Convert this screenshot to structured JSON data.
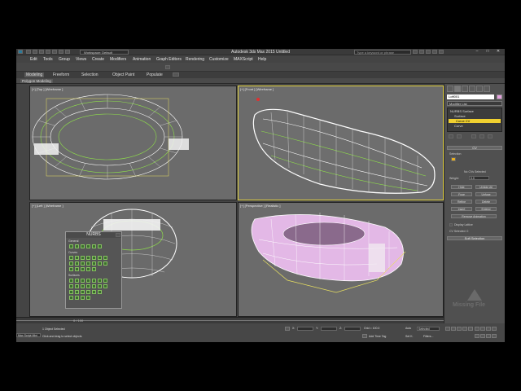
{
  "window": {
    "title": "Autodesk 3ds Max  2015    Untitled",
    "workspace": "Workspace: Default",
    "search_placeholder": "Type a keyword or phrase",
    "controls": [
      "–",
      "□",
      "✕"
    ]
  },
  "menu": [
    "Edit",
    "Tools",
    "Group",
    "Views",
    "Create",
    "Modifiers",
    "Animation",
    "Graph Editors",
    "Rendering",
    "Customize",
    "MAXScript",
    "Help"
  ],
  "ribbon": {
    "tabs": [
      "Modeling",
      "Freeform",
      "Selection",
      "Object Paint",
      "Populate"
    ],
    "active_tab": "Modeling",
    "panel_label": "Polygon Modeling"
  },
  "viewports": [
    {
      "label": "[+] [Top ] [Wireframe ]"
    },
    {
      "label": "[+] [Front ] [Wireframe ]"
    },
    {
      "label": "[+] [Left ] [Wireframe ]"
    },
    {
      "label": "[+] [Perspective ] [Realistic ]"
    }
  ],
  "command_panel": {
    "object_name": "Loft001",
    "object_color": "#e7a0e0",
    "modifier_list": "Modifier List",
    "stack": [
      "NURBS Surface",
      "Surface",
      "Curve CV",
      "Curve"
    ],
    "stack_selected": "Curve CV",
    "rollout_cv": "CV",
    "selection_label": "Selection",
    "no_cvs": "No CVs Selected",
    "weight_label": "Weight:",
    "weight_value": "0.0",
    "buttons": [
      "Hide",
      "Unhide All",
      "Fuse",
      "Unfuse",
      "Refine",
      "Delete",
      "Insert",
      "Extend"
    ],
    "remove_anim": "Remove Animation",
    "display_lattice": "Display Lattice",
    "cvs_selected": "CV Selected: 0",
    "soft_selection": "Soft Selection",
    "missing_file": "Missing File"
  },
  "nurbs_toolbox": {
    "title": "NURBS",
    "sections": [
      "General",
      "Curves",
      "Surfaces"
    ]
  },
  "status": {
    "selection": "1 Object Selected",
    "prompt": "Click and drag to select objects",
    "frame": "0 / 100",
    "x": "X:",
    "y": "Y:",
    "z": "Z:",
    "grid": "Grid = 100.0",
    "auto_key": "Auto",
    "set_key": "Set K.",
    "key_filter": "Selected",
    "filters": "Filters...",
    "add_time_tag": "Add Time Tag",
    "maxscript": "Max Script Mini"
  },
  "colors": {
    "wire_white": "#ffffff",
    "wire_green": "#8fe04a",
    "wire_yellow": "#e8e060",
    "shaded_pink": "#e3b8e6",
    "active_border": "#e0d040"
  }
}
